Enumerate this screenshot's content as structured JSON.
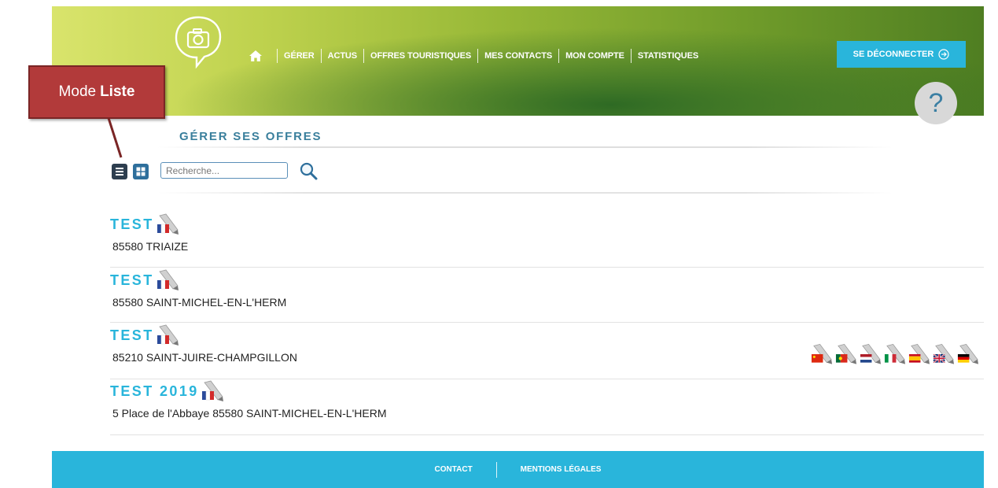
{
  "header": {
    "nav": [
      "GÉRER",
      "ACTUS",
      "OFFRES TOURISTIQUES",
      "MES CONTACTS",
      "MON COMPTE",
      "STATISTIQUES"
    ],
    "logout_label": "SE DÉCONNECTER",
    "help_label": "?"
  },
  "annotation": {
    "prefix": "Mode",
    "bold": "Liste"
  },
  "page": {
    "title": "GÉRER SES OFFRES"
  },
  "search": {
    "placeholder": "Recherche..."
  },
  "offers": [
    {
      "name": "TEST",
      "address": "85580 TRIAIZE",
      "translations": []
    },
    {
      "name": "TEST",
      "address": "85580 SAINT-MICHEL-EN-L'HERM",
      "translations": []
    },
    {
      "name": "TEST",
      "address": "85210 SAINT-JUIRE-CHAMPGILLON",
      "translations": [
        "cn",
        "pt",
        "nl",
        "it",
        "es",
        "gb",
        "de"
      ]
    },
    {
      "name": "TEST 2019",
      "address": "5 Place de l'Abbaye 85580 SAINT-MICHEL-EN-L'HERM",
      "translations": []
    }
  ],
  "footer": {
    "contact": "CONTACT",
    "legal": "MENTIONS LÉGALES"
  },
  "colors": {
    "accent": "#29b5db",
    "title": "#3a7f9c",
    "callout": "#b23a3a"
  },
  "icons": [
    "camera-chat-logo-icon",
    "home-icon",
    "logout-arrow-icon",
    "help-icon",
    "list-view-icon",
    "grid-view-icon",
    "search-icon",
    "pencil-flag-icon"
  ]
}
